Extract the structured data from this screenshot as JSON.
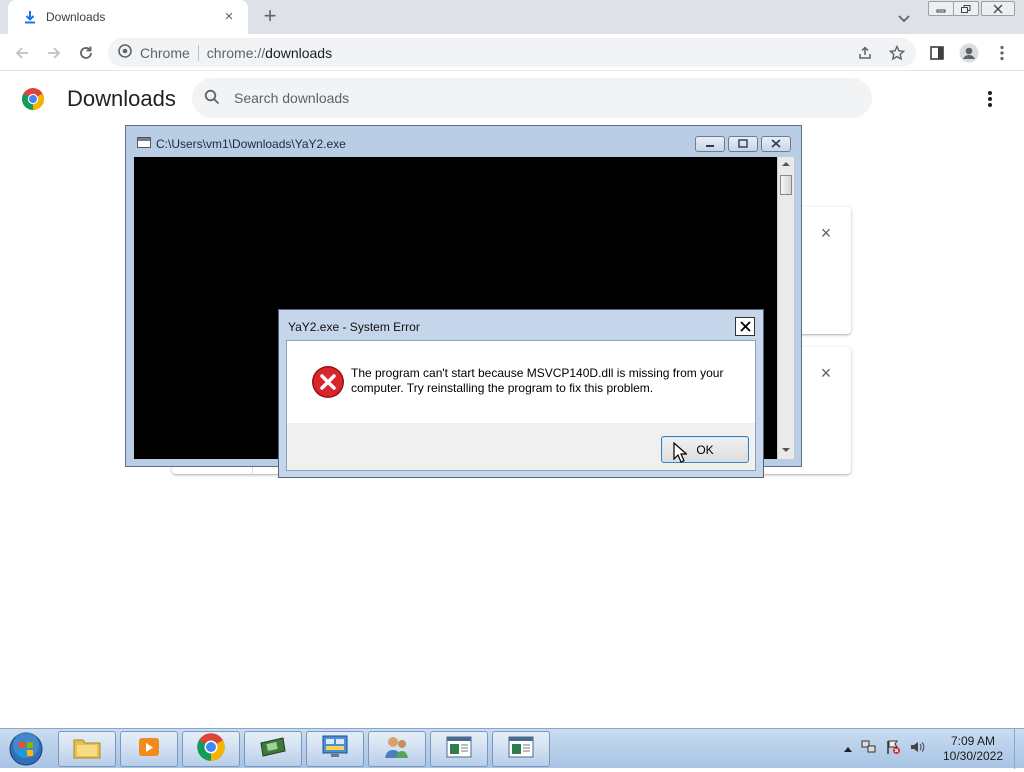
{
  "browser": {
    "tab": {
      "title": "Downloads",
      "close_label": "×"
    },
    "new_tab_label": "+",
    "omnibox": {
      "site_label": "Chrome",
      "url_scheme": "chrome://",
      "url_host": "downloads"
    }
  },
  "downloads_page": {
    "title": "Downloads",
    "search_placeholder": "Search downloads",
    "card_close_label": "×"
  },
  "console_window": {
    "title": "C:\\Users\\vm1\\Downloads\\YaY2.exe"
  },
  "error_dialog": {
    "title": "YaY2.exe - System Error",
    "close_label": "✕",
    "message": "The program can't start because MSVCP140D.dll is missing from your computer. Try reinstalling the program to fix this problem.",
    "ok_label": "OK"
  },
  "taskbar": {
    "items": [
      "file-explorer",
      "media-player",
      "chrome",
      "network-tool",
      "control-panel",
      "users-tool",
      "window-app-1",
      "window-app-2"
    ],
    "clock_time": "7:09 AM",
    "clock_date": "10/30/2022"
  },
  "colors": {
    "accent_blue": "#1a73e8",
    "error_red": "#c4161c",
    "taskbar": "#b7cde8"
  }
}
